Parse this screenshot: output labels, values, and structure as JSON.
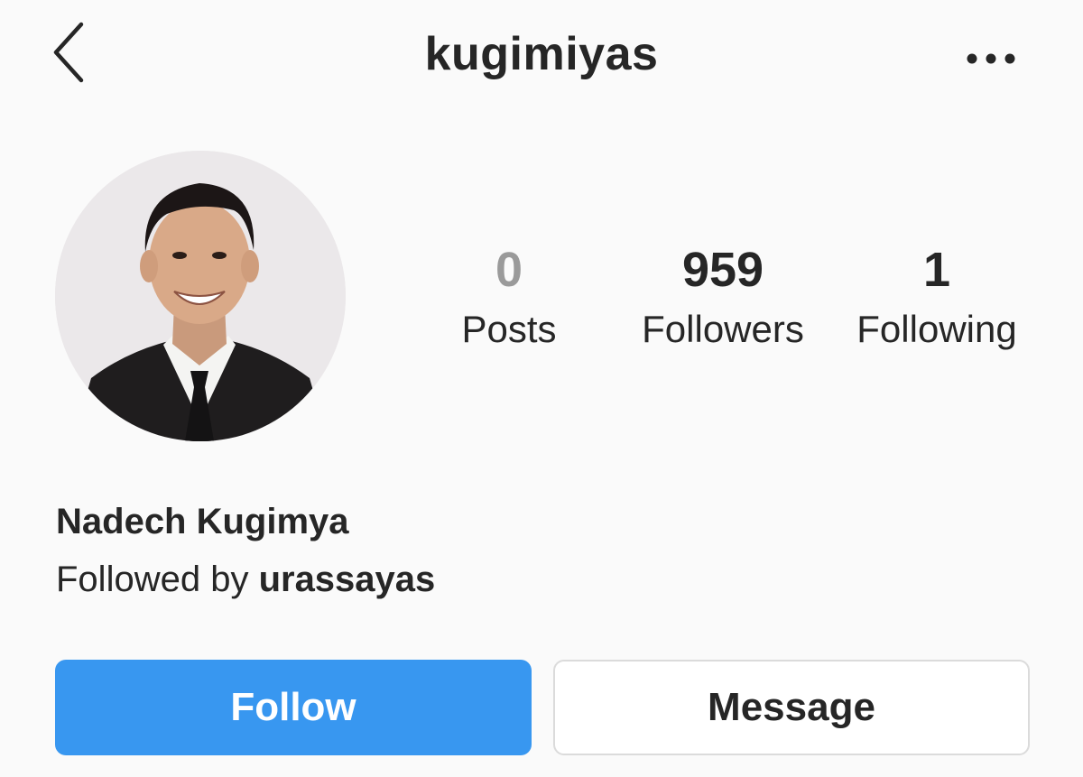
{
  "header": {
    "title": "kugimiyas",
    "back_icon": "chevron-left-icon",
    "more_icon": "more-horizontal-icon"
  },
  "profile": {
    "avatar_alt": "profile photo",
    "display_name": "Nadech Kugimya",
    "followed_by_prefix": "Followed by ",
    "followed_by_user": "urassayas"
  },
  "stats": {
    "posts": {
      "count": "0",
      "label": "Posts"
    },
    "followers": {
      "count": "959",
      "label": "Followers"
    },
    "following": {
      "count": "1",
      "label": "Following"
    }
  },
  "actions": {
    "follow_label": "Follow",
    "message_label": "Message"
  },
  "colors": {
    "accent": "#3897f0",
    "background": "#fafafa",
    "text": "#262626",
    "muted": "#9a9a9a"
  }
}
